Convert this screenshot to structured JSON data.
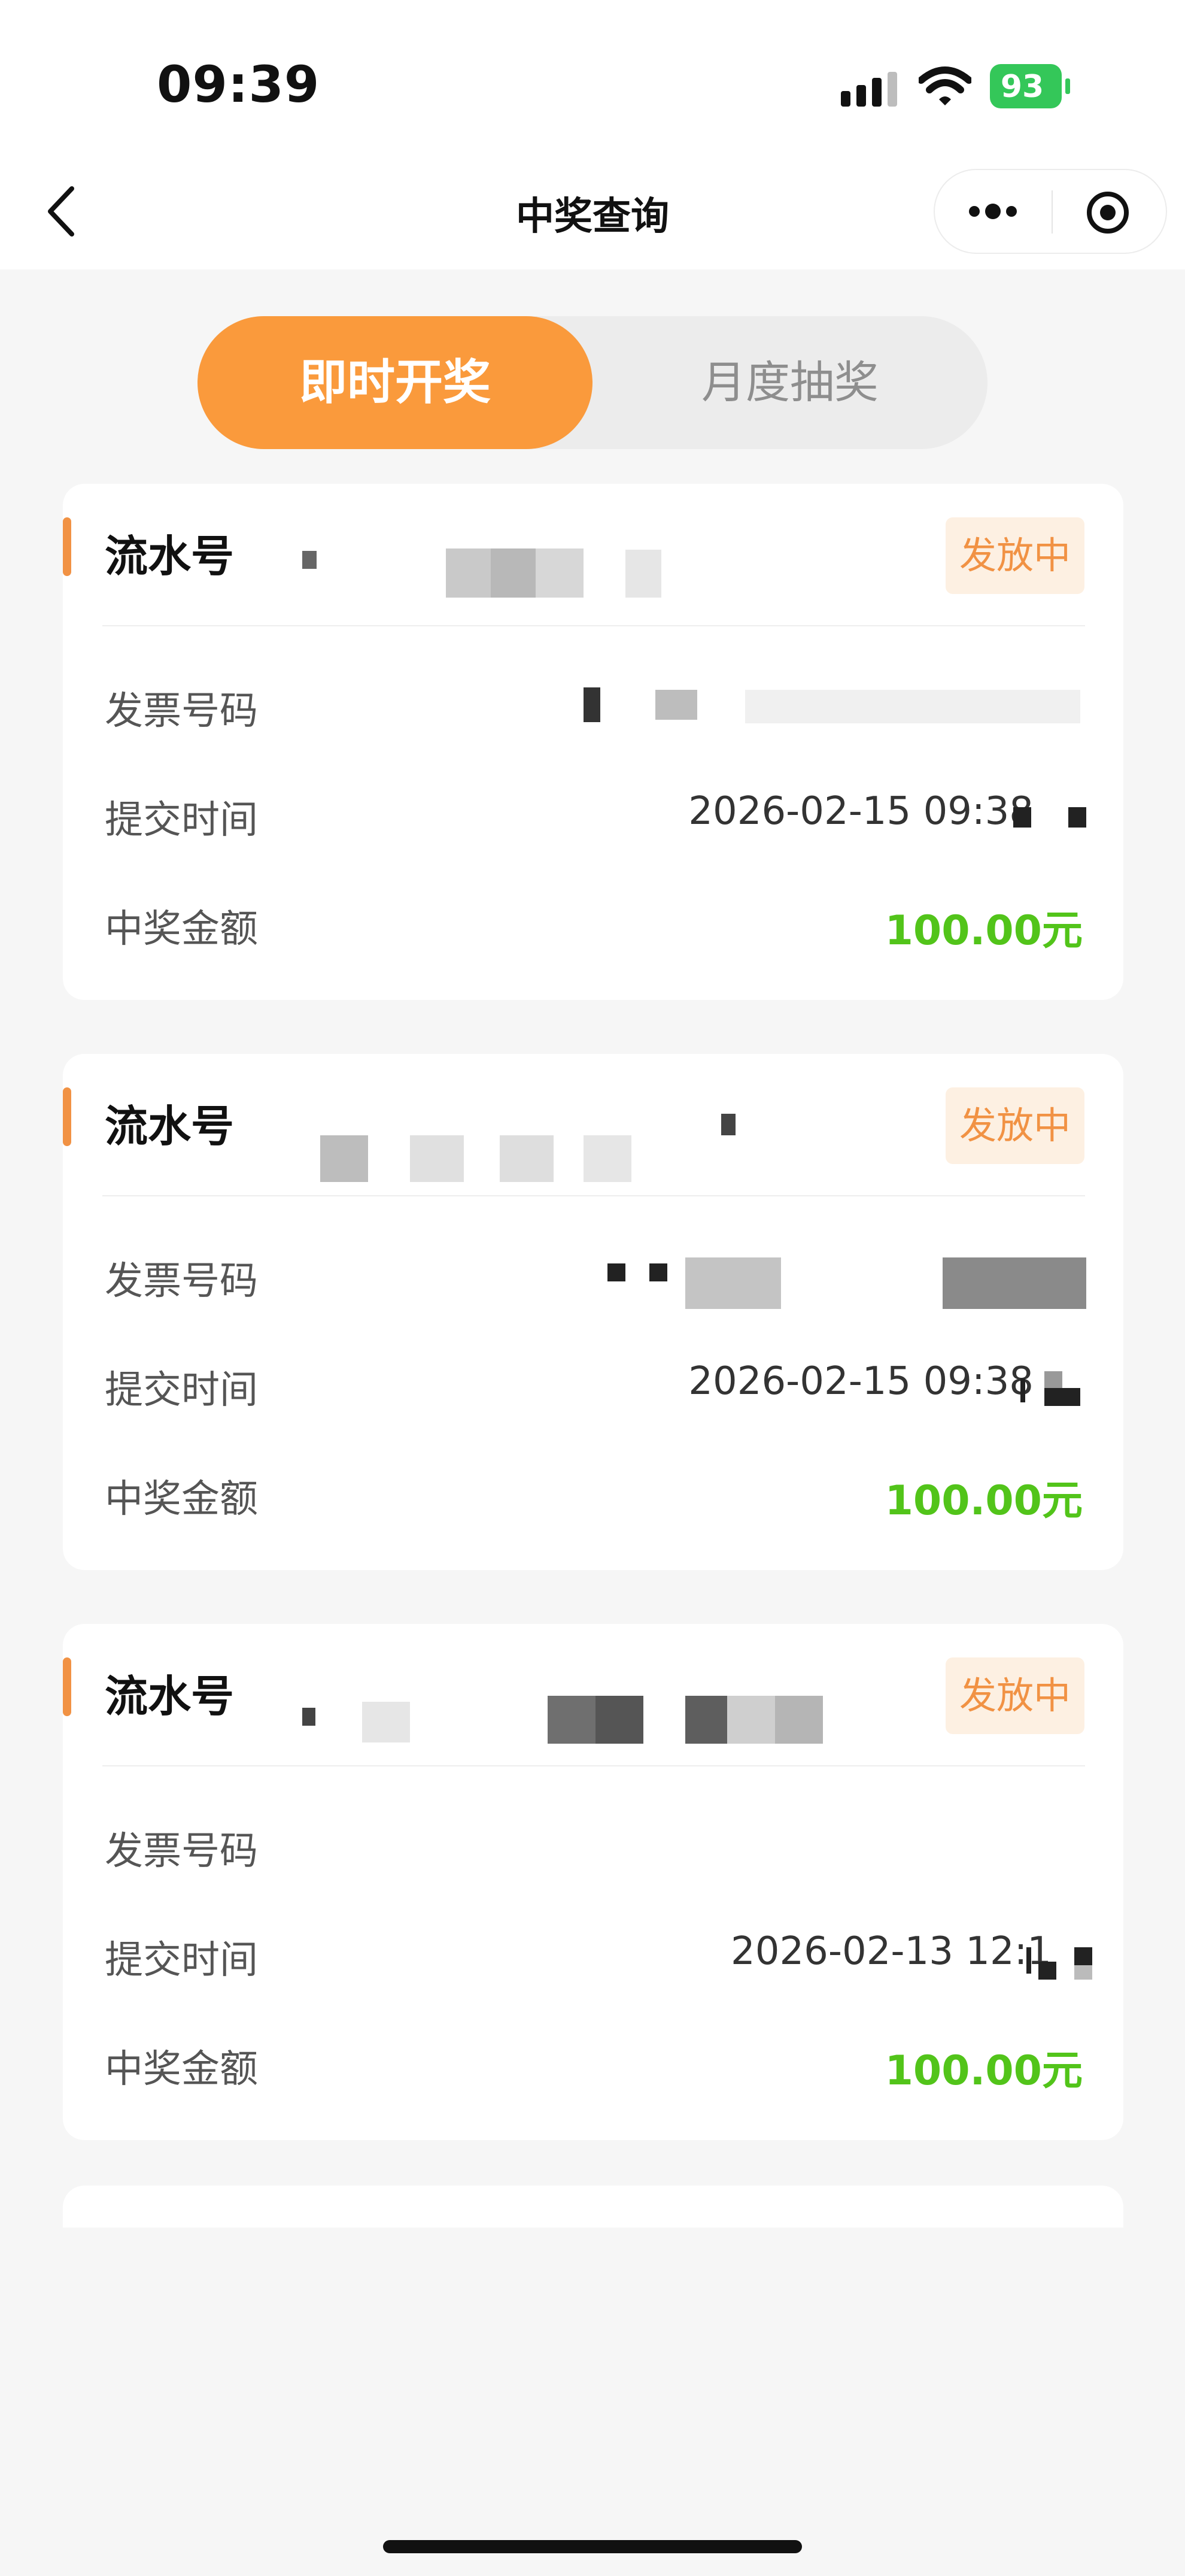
{
  "status_bar": {
    "time": "09:39",
    "battery": "93"
  },
  "nav": {
    "title": "中奖查询"
  },
  "tabs": [
    {
      "label": "即时开奖",
      "active": true
    },
    {
      "label": "月度抽奖",
      "active": false
    }
  ],
  "records": [
    {
      "serial_label": "流水号",
      "status": "发放中",
      "invoice_label": "发票号码",
      "submit_time_label": "提交时间",
      "submit_time": "2026-02-15 09:38",
      "amount_label": "中奖金额",
      "amount": "100.00元"
    },
    {
      "serial_label": "流水号",
      "status": "发放中",
      "invoice_label": "发票号码",
      "submit_time_label": "提交时间",
      "submit_time": "2026-02-15 09:38",
      "amount_label": "中奖金额",
      "amount": "100.00元"
    },
    {
      "serial_label": "流水号",
      "status": "发放中",
      "invoice_label": "发票号码",
      "submit_time_label": "提交时间",
      "submit_time": "2026-02-13 12:1",
      "amount_label": "中奖金额",
      "amount": "100.00元"
    }
  ],
  "colors": {
    "accent": "#fa9a3c",
    "status_text": "#f19244",
    "amount": "#52c41a"
  },
  "icons": [
    "back-icon",
    "more-icon",
    "target-icon",
    "signal-icon",
    "wifi-icon",
    "battery-icon"
  ]
}
